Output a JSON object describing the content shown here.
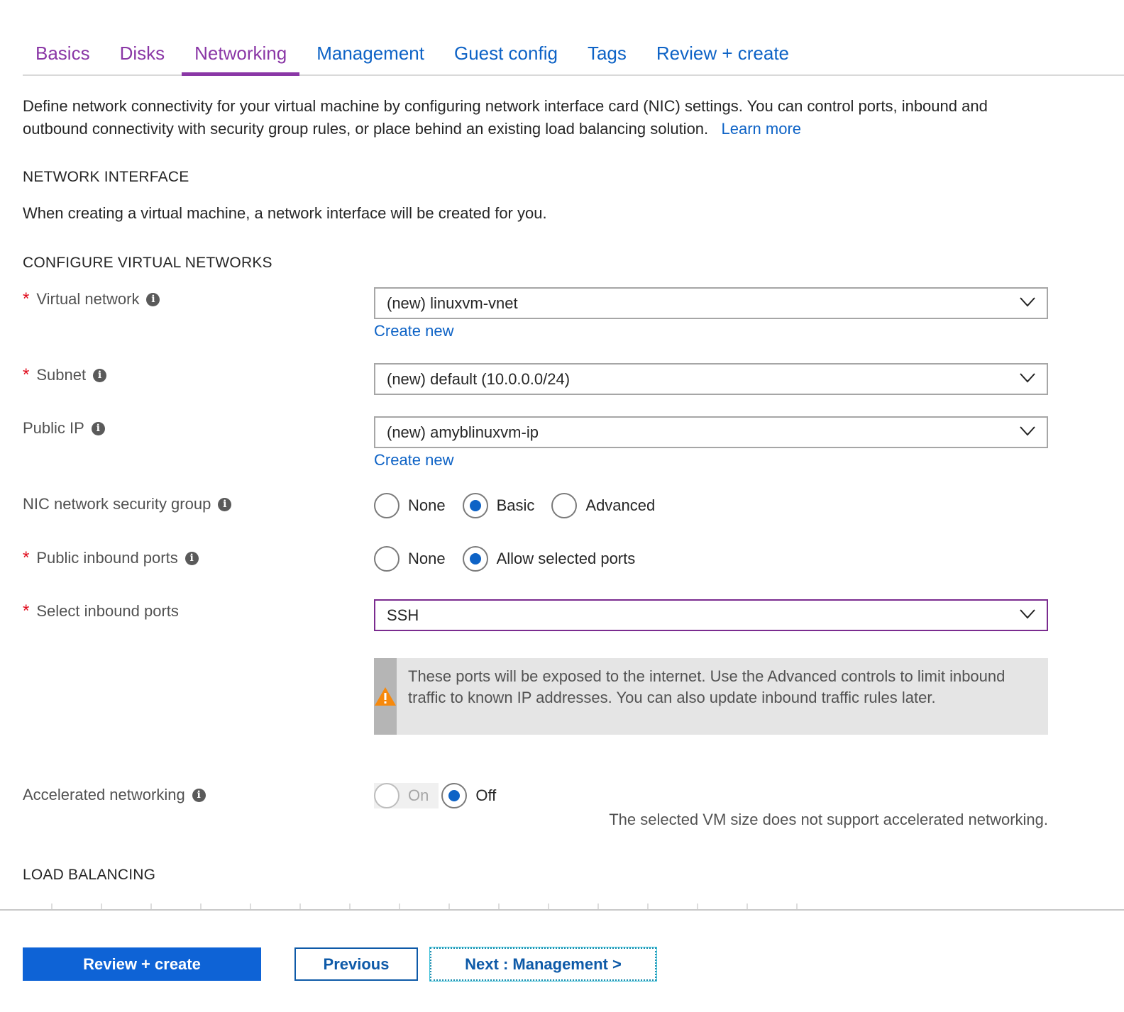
{
  "tabs": [
    {
      "label": "Basics",
      "state": "visited"
    },
    {
      "label": "Disks",
      "state": "visited"
    },
    {
      "label": "Networking",
      "state": "active"
    },
    {
      "label": "Management",
      "state": "default"
    },
    {
      "label": "Guest config",
      "state": "default"
    },
    {
      "label": "Tags",
      "state": "default"
    },
    {
      "label": "Review + create",
      "state": "default"
    }
  ],
  "intro": {
    "text": "Define network connectivity for your virtual machine by configuring network interface card (NIC) settings. You can control ports, inbound and outbound connectivity with security group rules, or place behind an existing load balancing solution.",
    "link": "Learn more"
  },
  "network_interface": {
    "title": "NETWORK INTERFACE",
    "description": "When creating a virtual machine, a network interface will be created for you."
  },
  "configure": {
    "title": "CONFIGURE VIRTUAL NETWORKS",
    "virtual_network": {
      "label": "Virtual network",
      "required": true,
      "value": "(new) linuxvm-vnet",
      "create_link": "Create new"
    },
    "subnet": {
      "label": "Subnet",
      "required": true,
      "value": "(new) default (10.0.0.0/24)"
    },
    "public_ip": {
      "label": "Public IP",
      "required": false,
      "value": "(new) amyblinuxvm-ip",
      "create_link": "Create new"
    },
    "nsg": {
      "label": "NIC network security group",
      "options": [
        "None",
        "Basic",
        "Advanced"
      ],
      "selected": "Basic"
    },
    "inbound": {
      "label": "Public inbound ports",
      "required": true,
      "options": [
        "None",
        "Allow selected ports"
      ],
      "selected": "Allow selected ports"
    },
    "select_ports": {
      "label": "Select inbound ports",
      "required": true,
      "value": "SSH"
    },
    "warning": "These ports will be exposed to the internet. Use the Advanced controls to limit inbound traffic to known IP addresses. You can also update inbound traffic rules later.",
    "accelerated": {
      "label": "Accelerated networking",
      "options": [
        "On",
        "Off"
      ],
      "selected": "Off",
      "disabled_option": "On",
      "note": "The selected VM size does not support accelerated networking."
    }
  },
  "load_balancing": {
    "title": "LOAD BALANCING"
  },
  "footer": {
    "review_create": "Review + create",
    "previous": "Previous",
    "next": "Next : Management >"
  },
  "colors": {
    "accent": "#0e63c6",
    "active_tab": "#8a37a6",
    "required": "#e00b1c",
    "warning_icon": "#f7890c",
    "primary_button": "#0e63d6"
  }
}
